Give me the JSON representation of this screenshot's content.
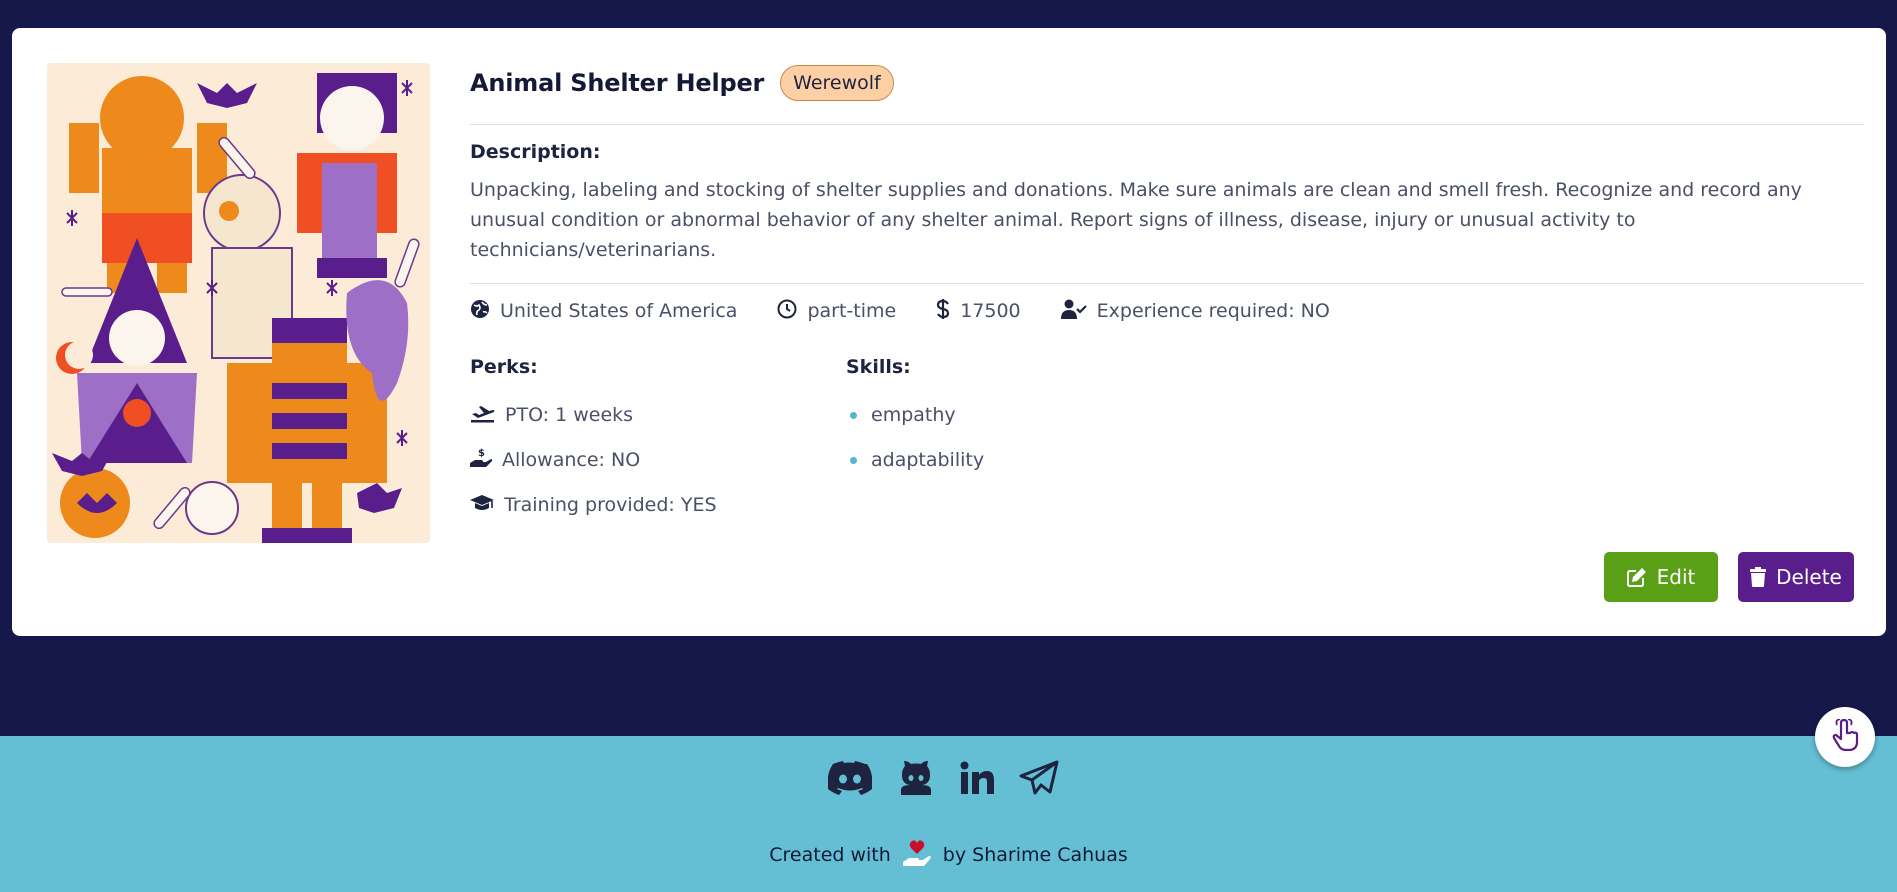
{
  "job": {
    "title": "Animal Shelter Helper",
    "badge": "Werewolf",
    "description_label": "Description:",
    "description": "Unpacking, labeling and stocking of shelter supplies and donations. Make sure animals are clean and smell fresh. Recognize and record any unusual condition or abnormal behavior of any shelter animal. Report signs of illness, disease, injury or unusual activity to technicians/veterinarians.",
    "country": "United States of America",
    "schedule": "part-time",
    "salary": "17500",
    "experience": "Experience required: NO",
    "perks_label": "Perks:",
    "perks": [
      {
        "icon": "plane-icon",
        "text": "PTO: 1 weeks"
      },
      {
        "icon": "hand-dollar-icon",
        "text": "Allowance: NO"
      },
      {
        "icon": "graduation-cap-icon",
        "text": "Training provided: YES"
      }
    ],
    "skills_label": "Skills:",
    "skills": [
      "empathy",
      "adaptability"
    ]
  },
  "actions": {
    "edit_label": "Edit",
    "delete_label": "Delete"
  },
  "footer": {
    "socials": [
      "discord-icon",
      "github-icon",
      "linkedin-icon",
      "telegram-icon"
    ],
    "created_with": "Created with",
    "by": "by Sharime Cahuas"
  },
  "colors": {
    "background": "#17184a",
    "footer": "#65bfd4",
    "edit_button": "#5aa016",
    "delete_button": "#5a1e8c",
    "badge": "#fcd0a4"
  }
}
